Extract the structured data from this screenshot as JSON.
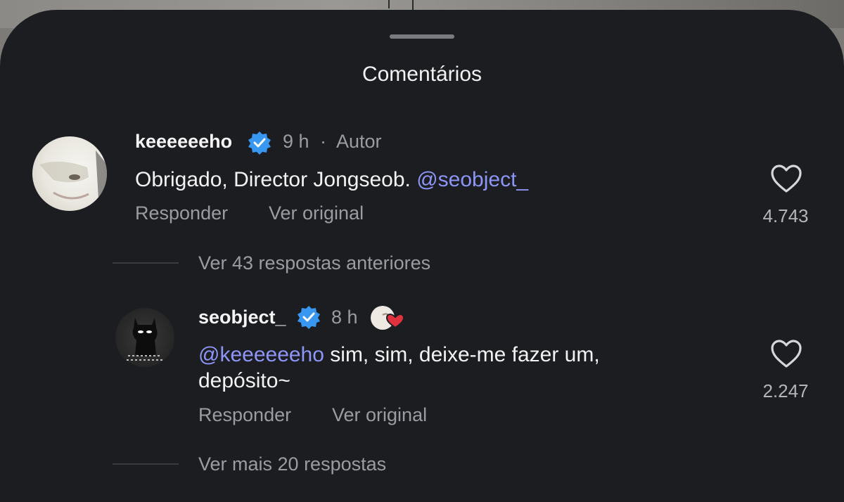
{
  "header": {
    "title": "Comentários"
  },
  "comments": [
    {
      "username": "keeeeeeho",
      "time": "9 h",
      "role": "Autor",
      "text": "Obrigado, Director Jongseob. ",
      "mention": "@seobject_",
      "reply_label": "Responder",
      "original_label": "Ver original",
      "likes": "4.743"
    },
    {
      "username": "seobject_",
      "time": "8 h",
      "mention": "@keeeeeeho",
      "text_line1": " sim, sim, deixe-me fazer um,",
      "text_line2": "depósito~",
      "reply_label": "Responder",
      "original_label": "Ver original",
      "likes": "2.247"
    }
  ],
  "threads": {
    "previous_replies": "Ver 43 respostas anteriores",
    "more_replies": "Ver mais 20 respostas"
  },
  "colors": {
    "sheet": "#1c1d21",
    "mention": "#8d95f6",
    "verified": "#3897f0"
  }
}
